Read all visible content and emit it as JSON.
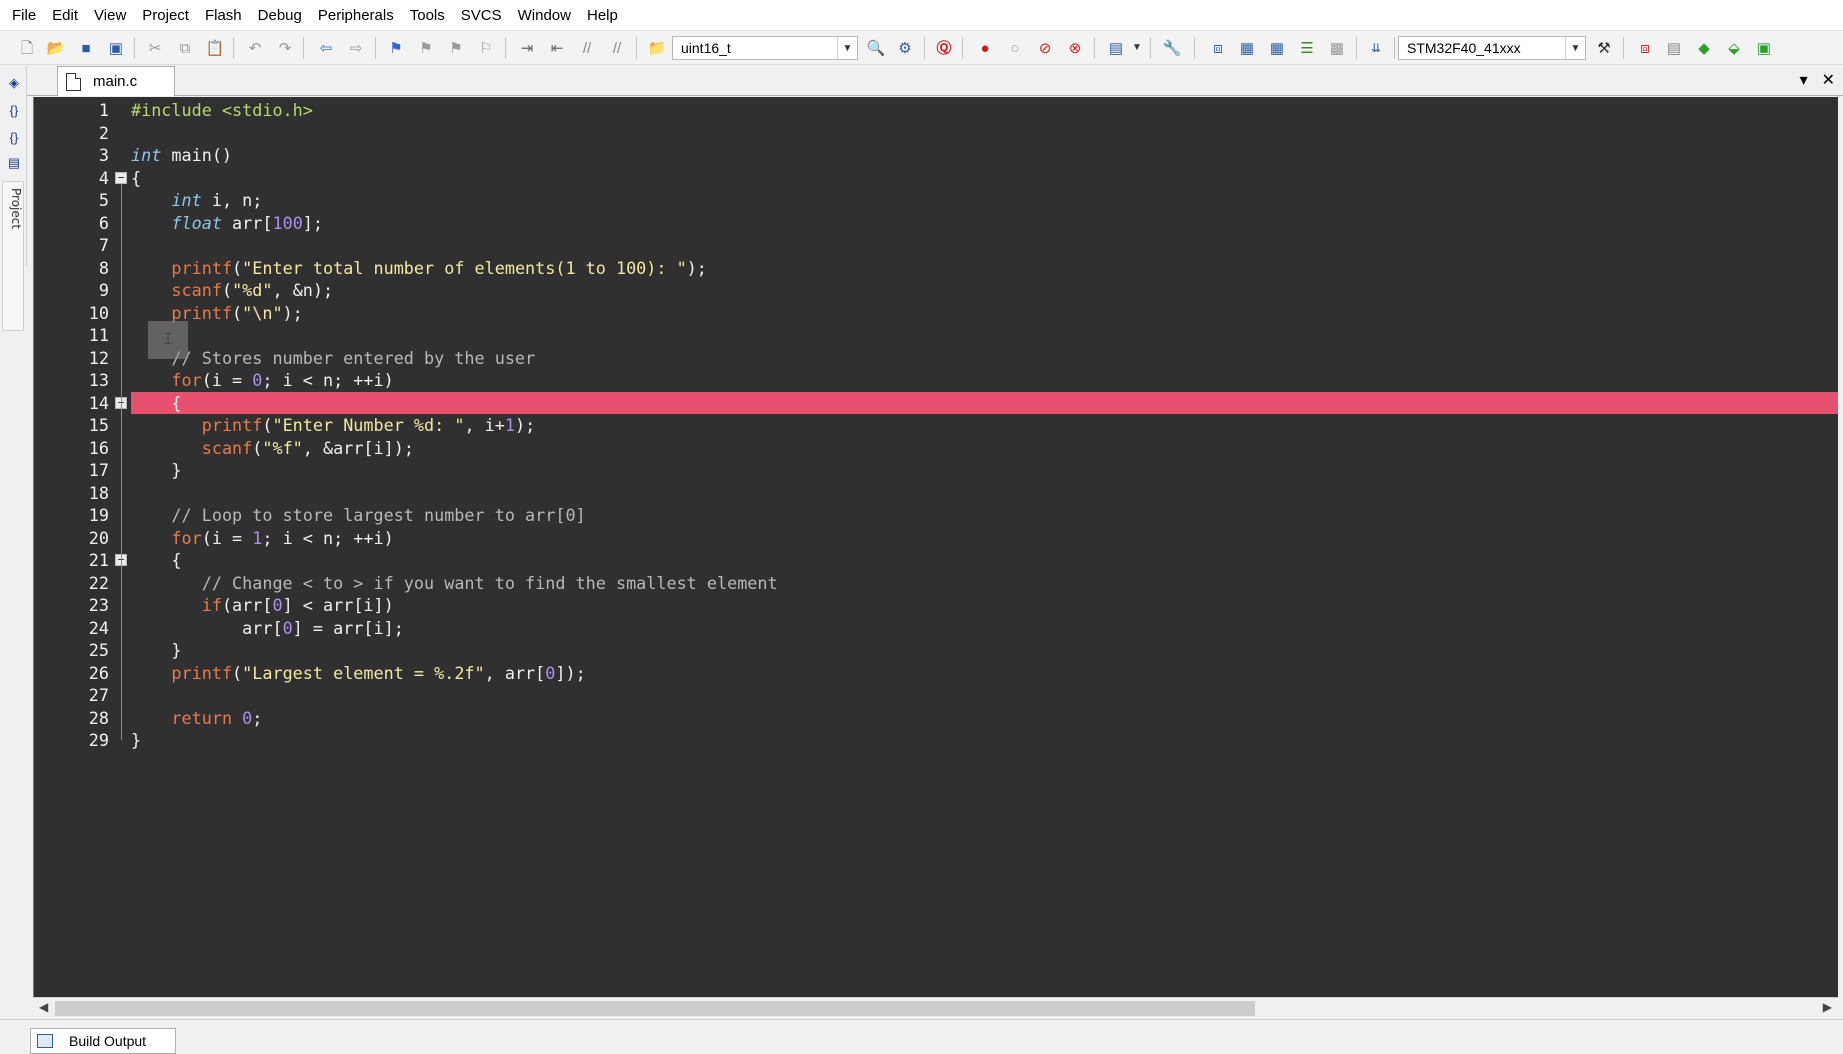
{
  "menu": [
    "File",
    "Edit",
    "View",
    "Project",
    "Flash",
    "Debug",
    "Peripherals",
    "Tools",
    "SVCS",
    "Window",
    "Help"
  ],
  "toolbar": {
    "find_combo_value": "uint16_t",
    "target_combo_value": "STM32F40_41xxx",
    "icons": [
      "new-file",
      "open-folder",
      "save",
      "save-all",
      "cut",
      "copy",
      "paste",
      "undo",
      "redo",
      "nav-back",
      "nav-forward",
      "bookmark",
      "bookmark-prev",
      "bookmark-next",
      "bookmark-clear",
      "indent",
      "unindent",
      "comment",
      "uncomment",
      "find-in-files",
      "find",
      "replace",
      "debug-session",
      "breakpoint",
      "breakpoint-disable",
      "breakpoint-disable-all",
      "breakpoint-kill",
      "window-layout",
      "configure",
      "translate",
      "build",
      "rebuild",
      "batch-build",
      "stop-build",
      "download",
      "target-options",
      "manage-components",
      "select-packs",
      "pack-installer",
      "event-recorder"
    ]
  },
  "sidebar": {
    "project_label": "Project"
  },
  "tab": {
    "label": "main.c"
  },
  "editor": {
    "lines": [
      {
        "n": "1",
        "text": "#include <stdio.h>"
      },
      {
        "n": "2",
        "text": ""
      },
      {
        "n": "3",
        "text": "int main()"
      },
      {
        "n": "4",
        "text": "{"
      },
      {
        "n": "5",
        "text": "    int i, n;"
      },
      {
        "n": "6",
        "text": "    float arr[100];"
      },
      {
        "n": "7",
        "text": ""
      },
      {
        "n": "8",
        "text": "    printf(\"Enter total number of elements(1 to 100): \");"
      },
      {
        "n": "9",
        "text": "    scanf(\"%d\", &n);"
      },
      {
        "n": "10",
        "text": "    printf(\"\\n\");"
      },
      {
        "n": "11",
        "text": ""
      },
      {
        "n": "12",
        "text": "    // Stores number entered by the user"
      },
      {
        "n": "13",
        "text": "    for(i = 0; i < n; ++i)"
      },
      {
        "n": "14",
        "text": "    {"
      },
      {
        "n": "15",
        "text": "       printf(\"Enter Number %d: \", i+1);"
      },
      {
        "n": "16",
        "text": "       scanf(\"%f\", &arr[i]);"
      },
      {
        "n": "17",
        "text": "    }"
      },
      {
        "n": "18",
        "text": ""
      },
      {
        "n": "19",
        "text": "    // Loop to store largest number to arr[0]"
      },
      {
        "n": "20",
        "text": "    for(i = 1; i < n; ++i)"
      },
      {
        "n": "21",
        "text": "    {"
      },
      {
        "n": "22",
        "text": "       // Change < to > if you want to find the smallest element"
      },
      {
        "n": "23",
        "text": "       if(arr[0] < arr[i])"
      },
      {
        "n": "24",
        "text": "           arr[0] = arr[i];"
      },
      {
        "n": "25",
        "text": "    }"
      },
      {
        "n": "26",
        "text": "    printf(\"Largest element = %.2f\", arr[0]);"
      },
      {
        "n": "27",
        "text": ""
      },
      {
        "n": "28",
        "text": "    return 0;"
      },
      {
        "n": "29",
        "text": "}"
      }
    ],
    "highlighted_line": 14
  },
  "bottom": {
    "build_output_label": "Build Output"
  },
  "colors": {
    "editor_bg": "#303030",
    "highlight": "#e8506f",
    "keyword": "#8ac7e8",
    "function": "#e77b4e",
    "string": "#f3e7a2",
    "number": "#ad8eea",
    "comment": "#b8b8b8",
    "preprocessor": "#b9d96f"
  }
}
